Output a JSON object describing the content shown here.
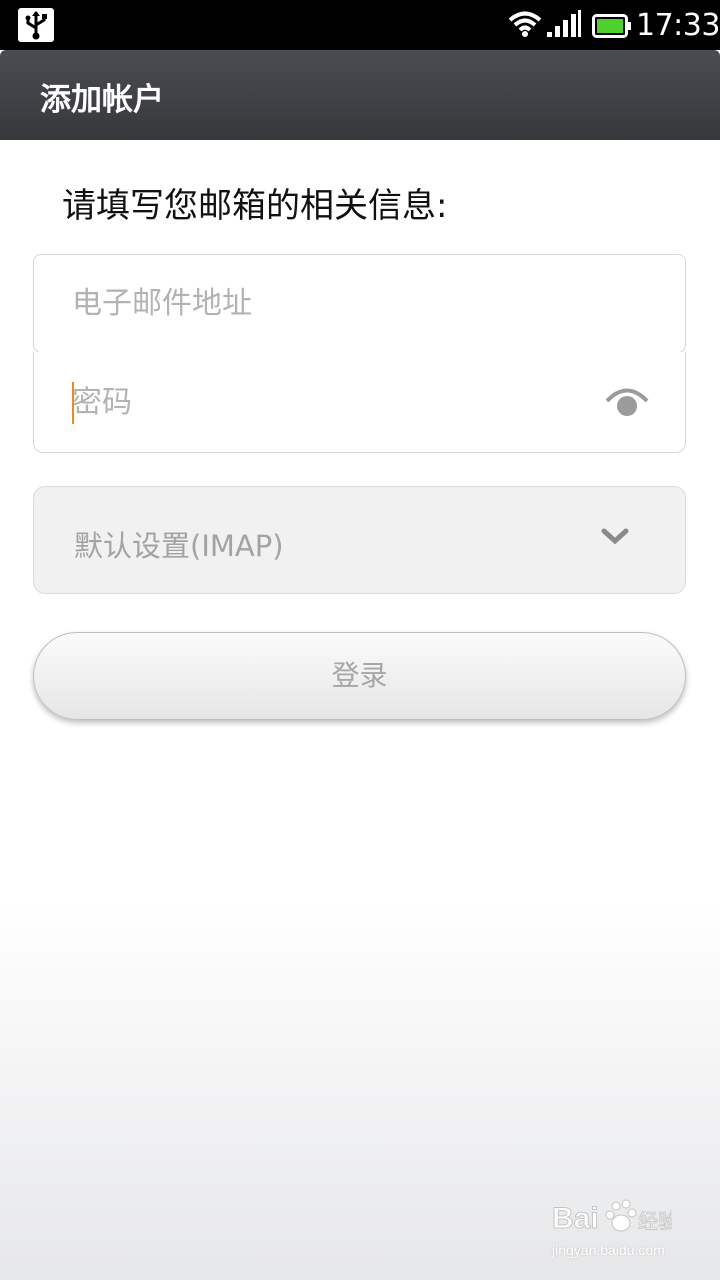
{
  "status_bar": {
    "time": "17:33",
    "icons": [
      "usb-icon",
      "wifi-icon",
      "signal-icon",
      "battery-icon"
    ]
  },
  "title_bar": {
    "title": "添加帐户"
  },
  "form": {
    "prompt": "请填写您邮箱的相关信息:",
    "email_placeholder": "电子邮件地址",
    "email_value": "",
    "password_placeholder": "密码",
    "password_value": "",
    "setting_selected": "默认设置(IMAP)",
    "login_label": "登录"
  },
  "watermark": {
    "brand": "Bai 经验",
    "url": "jingyan.baidu.com"
  },
  "colors": {
    "title_bar": "#3e4044",
    "caret": "#f08a1e",
    "placeholder": "#b3b3b3",
    "button_text": "#a6a6a6"
  }
}
